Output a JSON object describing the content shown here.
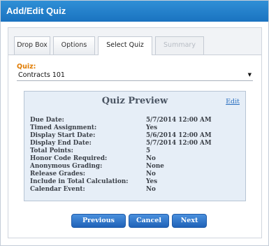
{
  "window": {
    "title": "Add/Edit Quiz"
  },
  "tabs": [
    {
      "label": "Drop Box"
    },
    {
      "label": "Options"
    },
    {
      "label": "Select Quiz"
    },
    {
      "label": "Summary"
    }
  ],
  "quiz_field": {
    "label": "Quiz:",
    "value": "Contracts 101",
    "arrow": "▼"
  },
  "preview": {
    "title": "Quiz Preview",
    "edit_label": "Edit",
    "rows": [
      {
        "key": "Due Date:",
        "value": "5/7/2014 12:00 AM"
      },
      {
        "key": "Timed Assignment:",
        "value": "Yes"
      },
      {
        "key": "Display Start Date:",
        "value": "5/6/2014 12:00 AM"
      },
      {
        "key": "Display End Date:",
        "value": "5/7/2014 12:00 AM"
      },
      {
        "key": "Total Points:",
        "value": "5"
      },
      {
        "key": "Honor Code Required:",
        "value": "No"
      },
      {
        "key": "Anonymous Grading:",
        "value": "None"
      },
      {
        "key": "Release Grades:",
        "value": "No"
      },
      {
        "key": "Include in Total Calculation:",
        "value": "Yes"
      },
      {
        "key": "Calendar Event:",
        "value": "No"
      }
    ]
  },
  "buttons": {
    "previous": "Previous",
    "cancel": "Cancel",
    "next": "Next"
  },
  "colors": {
    "title_bar": "#1a73c0",
    "field_label": "#e07b00",
    "preview_bg": "#e6eef7",
    "button": "#1f62b8"
  }
}
